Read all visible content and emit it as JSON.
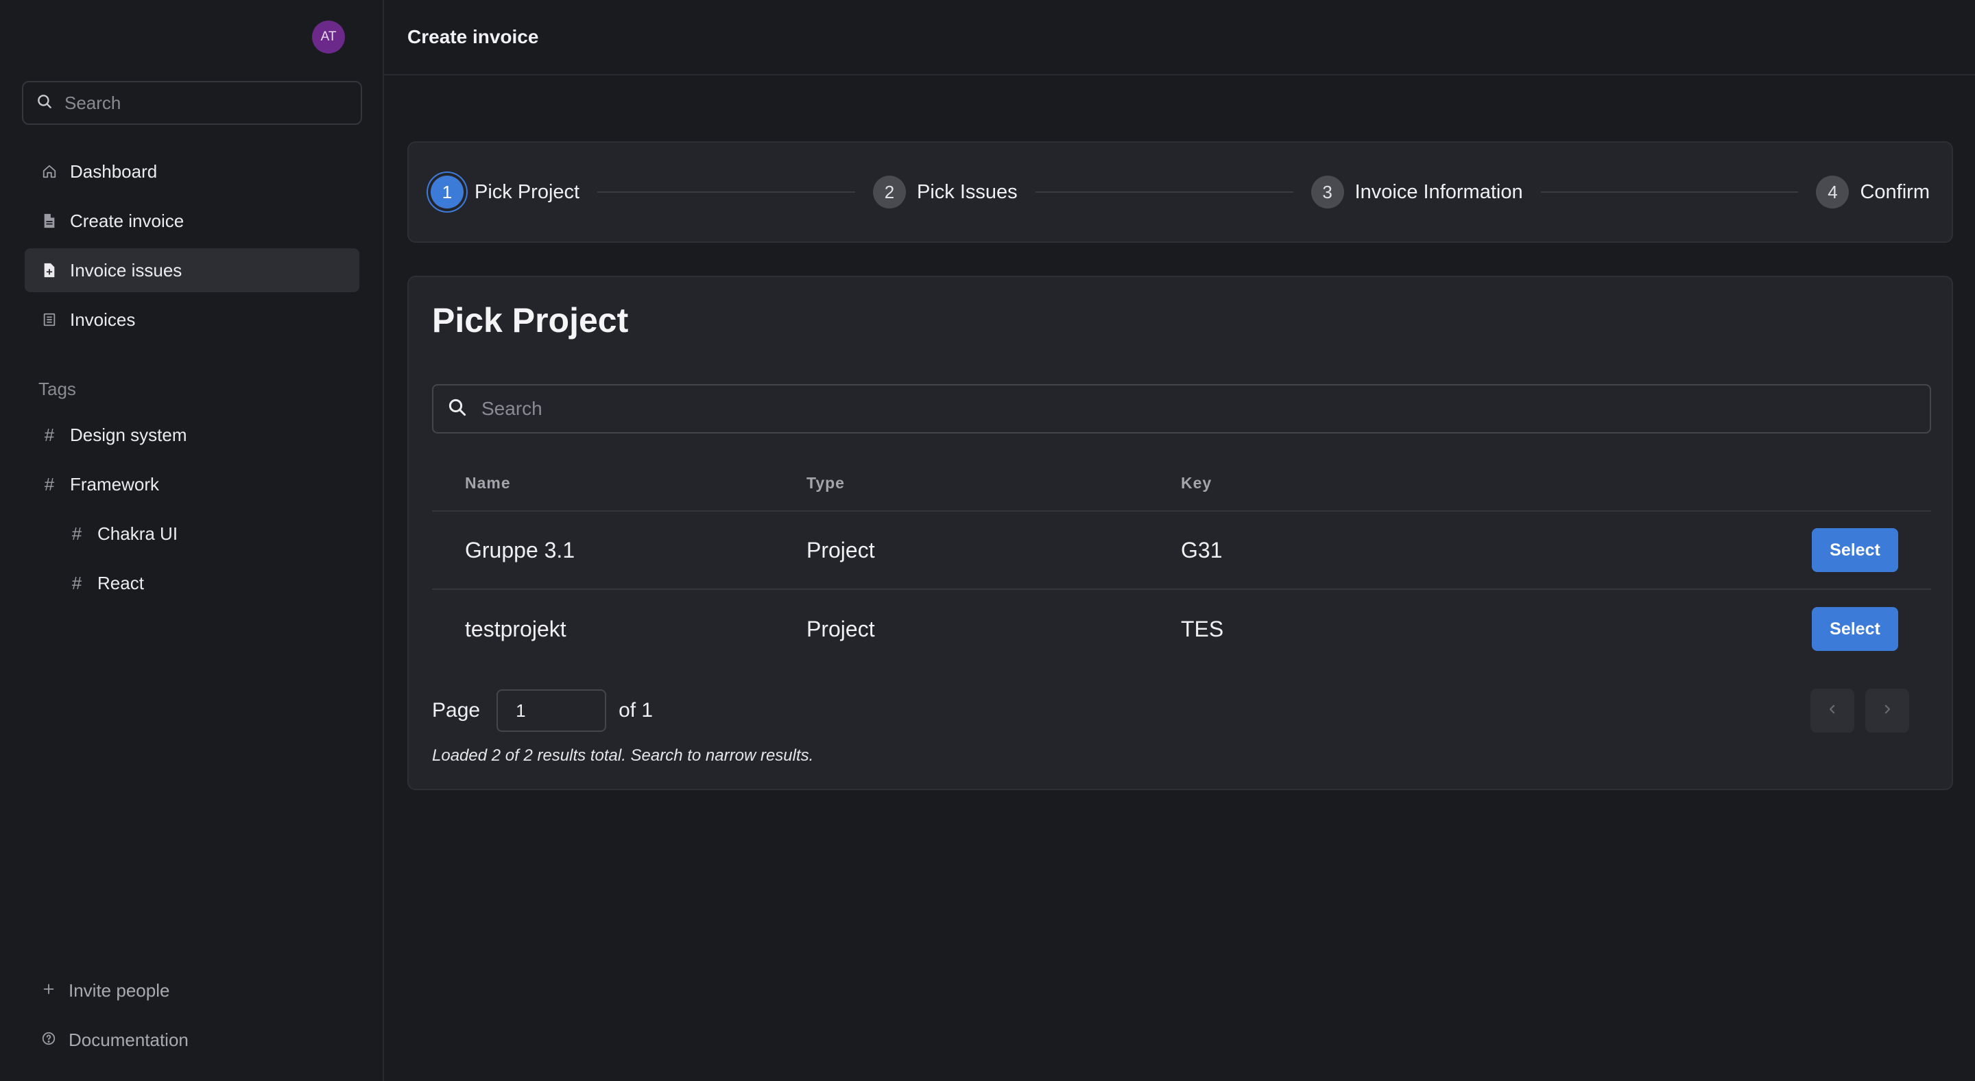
{
  "user": {
    "initials": "AT"
  },
  "sidebar": {
    "search_placeholder": "Search",
    "items": [
      {
        "label": "Dashboard",
        "icon": "home-icon"
      },
      {
        "label": "Create invoice",
        "icon": "file-icon"
      },
      {
        "label": "Invoice issues",
        "icon": "file-plus-icon",
        "active": true
      },
      {
        "label": "Invoices",
        "icon": "list-icon"
      }
    ],
    "tags_title": "Tags",
    "tags": [
      {
        "label": "Design system"
      },
      {
        "label": "Framework"
      },
      {
        "label": "Chakra UI"
      },
      {
        "label": "React"
      }
    ],
    "bottom": [
      {
        "label": "Invite people",
        "icon": "plus-icon"
      },
      {
        "label": "Documentation",
        "icon": "help-icon"
      }
    ]
  },
  "header": {
    "title": "Create invoice"
  },
  "stepper": {
    "steps": [
      {
        "number": "1",
        "label": "Pick Project"
      },
      {
        "number": "2",
        "label": "Pick Issues"
      },
      {
        "number": "3",
        "label": "Invoice Information"
      },
      {
        "number": "4",
        "label": "Confirm"
      }
    ],
    "active_step": 1
  },
  "card": {
    "title": "Pick Project",
    "search_placeholder": "Search",
    "table": {
      "headers": [
        "Name",
        "Type",
        "Key"
      ],
      "rows": [
        {
          "name": "Gruppe 3.1",
          "type": "Project",
          "key": "G31",
          "action": "Select"
        },
        {
          "name": "testprojekt",
          "type": "Project",
          "key": "TES",
          "action": "Select"
        }
      ]
    },
    "pager": {
      "page_label": "Page",
      "current_page": "1",
      "of_label": "of 1"
    },
    "footnote": "Loaded 2 of 2 results total. Search to narrow results."
  },
  "colors": {
    "accent": "#3d7bd9",
    "background": "#1a1b1f",
    "card": "#24252a",
    "avatar": "#6b2a8a"
  }
}
